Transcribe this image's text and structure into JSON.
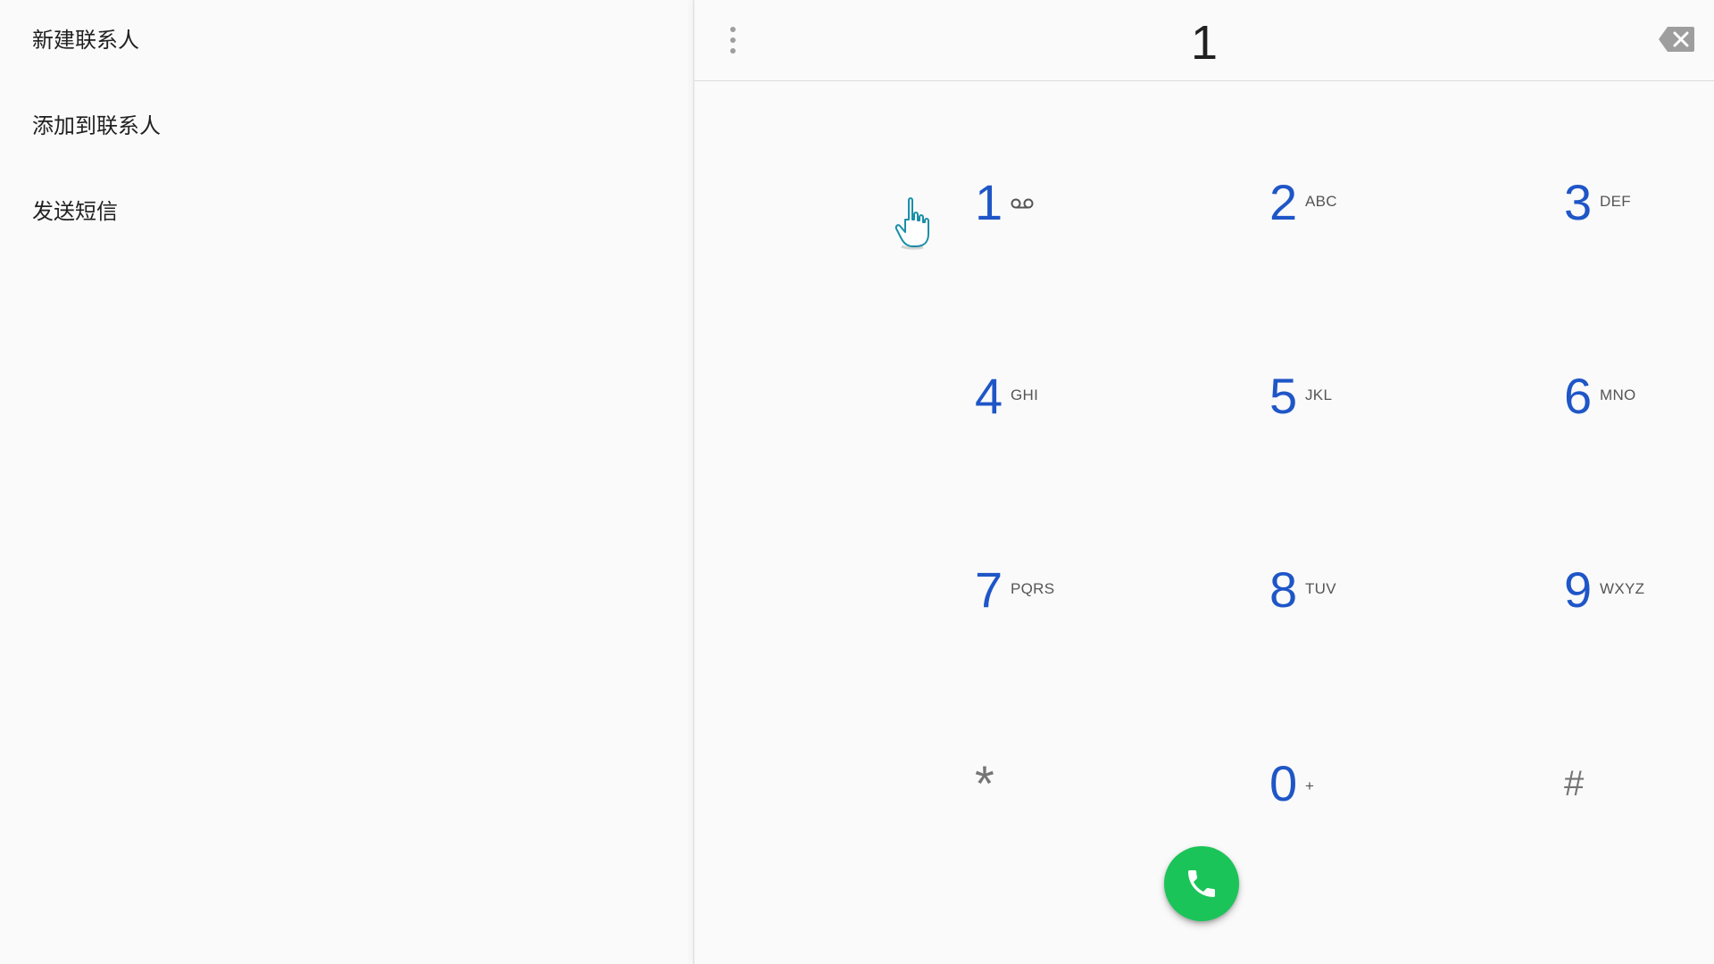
{
  "left_panel": {
    "items": [
      {
        "label": "新建联系人"
      },
      {
        "label": "添加到联系人"
      },
      {
        "label": "发送短信"
      }
    ]
  },
  "dialpad": {
    "entered_digits": "1",
    "overflow_icon": "more-vert-icon",
    "backspace_icon": "backspace-icon",
    "keys": [
      {
        "digit": "1",
        "letters": "",
        "icon": "voicemail-icon"
      },
      {
        "digit": "2",
        "letters": "ABC"
      },
      {
        "digit": "3",
        "letters": "DEF"
      },
      {
        "digit": "4",
        "letters": "GHI"
      },
      {
        "digit": "5",
        "letters": "JKL"
      },
      {
        "digit": "6",
        "letters": "MNO"
      },
      {
        "digit": "7",
        "letters": "PQRS"
      },
      {
        "digit": "8",
        "letters": "TUV"
      },
      {
        "digit": "9",
        "letters": "WXYZ"
      },
      {
        "digit": "*",
        "letters": ""
      },
      {
        "digit": "0",
        "letters": "+"
      },
      {
        "digit": "#",
        "letters": ""
      }
    ],
    "call_button_icon": "phone-icon",
    "call_button_color": "#1bc458",
    "digit_color": "#1f56c7"
  }
}
